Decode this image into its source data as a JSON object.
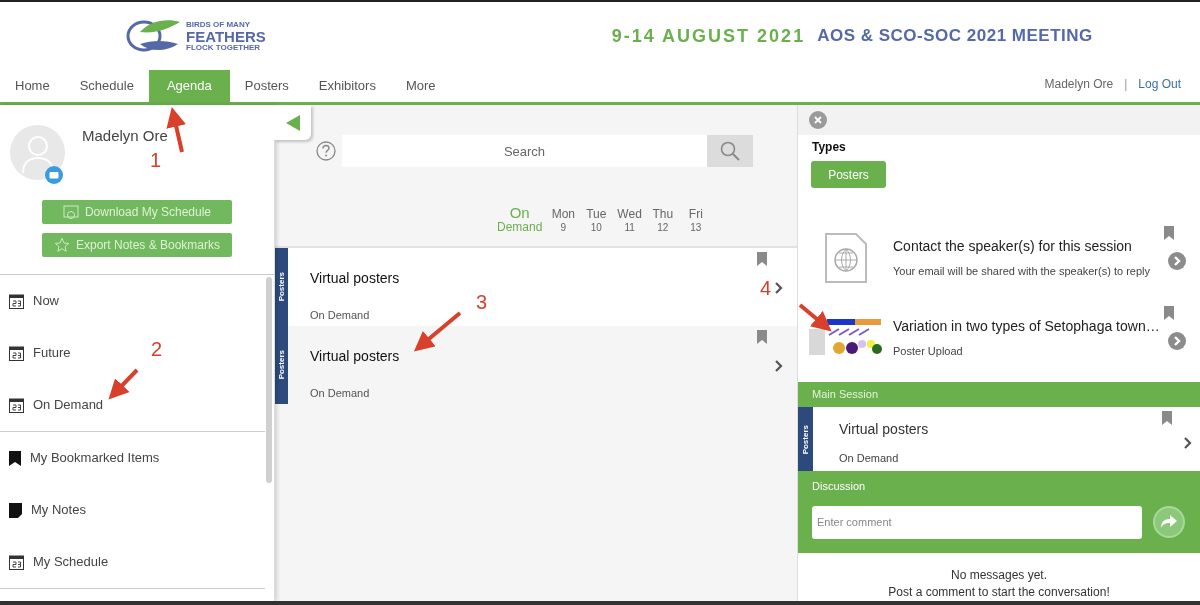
{
  "header": {
    "logo_lines": [
      "BIRDS OF MANY",
      "FEATHERS",
      "FLOCK TOGETHER"
    ],
    "dates": "9-14 AUGUST 2021",
    "meeting": "AOS & SCO-SOC 2021 MEETING"
  },
  "nav": {
    "tabs": [
      {
        "label": "Home",
        "selected": false
      },
      {
        "label": "Schedule",
        "selected": false
      },
      {
        "label": "Agenda",
        "selected": true
      },
      {
        "label": "Posters",
        "selected": false
      },
      {
        "label": "Exhibitors",
        "selected": false
      },
      {
        "label": "More",
        "selected": false
      }
    ],
    "user": "Madelyn Ore",
    "separator": "|",
    "logout": "Log Out"
  },
  "profile": {
    "name": "Madelyn Ore",
    "buttons": [
      {
        "label": "Download My Schedule",
        "kind": "download"
      },
      {
        "label": "Export Notes & Bookmarks",
        "kind": "star"
      }
    ]
  },
  "sidebar": {
    "groups": [
      {
        "items": [
          {
            "label": "Now",
            "kind": "calendar"
          },
          {
            "label": "Future",
            "kind": "calendar"
          },
          {
            "label": "On Demand",
            "kind": "calendar"
          }
        ]
      },
      {
        "items": [
          {
            "label": "My Bookmarked Items",
            "kind": "bookmark"
          },
          {
            "label": "My Notes",
            "kind": "note"
          },
          {
            "label": "My Schedule",
            "kind": "calendar"
          }
        ]
      }
    ]
  },
  "search": {
    "placeholder": "Search"
  },
  "day_tabs": [
    {
      "day": "On",
      "date": "Demand",
      "selected": true
    },
    {
      "day": "Mon",
      "date": "9",
      "selected": false
    },
    {
      "day": "Tue",
      "date": "10",
      "selected": false
    },
    {
      "day": "Wed",
      "date": "11",
      "selected": false
    },
    {
      "day": "Thu",
      "date": "12",
      "selected": false
    },
    {
      "day": "Fri",
      "date": "13",
      "selected": false
    }
  ],
  "sessions": [
    {
      "tag": "Posters",
      "title": "Virtual posters",
      "time": "On Demand"
    },
    {
      "tag": "Posters",
      "title": "Virtual posters",
      "time": "On Demand"
    }
  ],
  "detail": {
    "types_heading": "Types",
    "types": [
      "Posters"
    ],
    "items": [
      {
        "kind": "web",
        "title": "Contact the speaker(s) for this session",
        "subtitle": "Your email will be shared with the speaker(s) to reply"
      },
      {
        "kind": "poster",
        "title": "Variation in two types of Setophaga town…",
        "subtitle": "Poster Upload"
      }
    ],
    "main_session": {
      "heading": "Main Session",
      "tag": "Posters",
      "title": "Virtual posters",
      "time": "On Demand"
    },
    "discussion": {
      "heading": "Discussion",
      "placeholder": "Enter comment"
    },
    "empty_messages": [
      "No messages yet.",
      "Post a comment to start the conversation!"
    ]
  },
  "annotations": [
    {
      "label": "1"
    },
    {
      "label": "2"
    },
    {
      "label": "3"
    },
    {
      "label": "4"
    }
  ]
}
